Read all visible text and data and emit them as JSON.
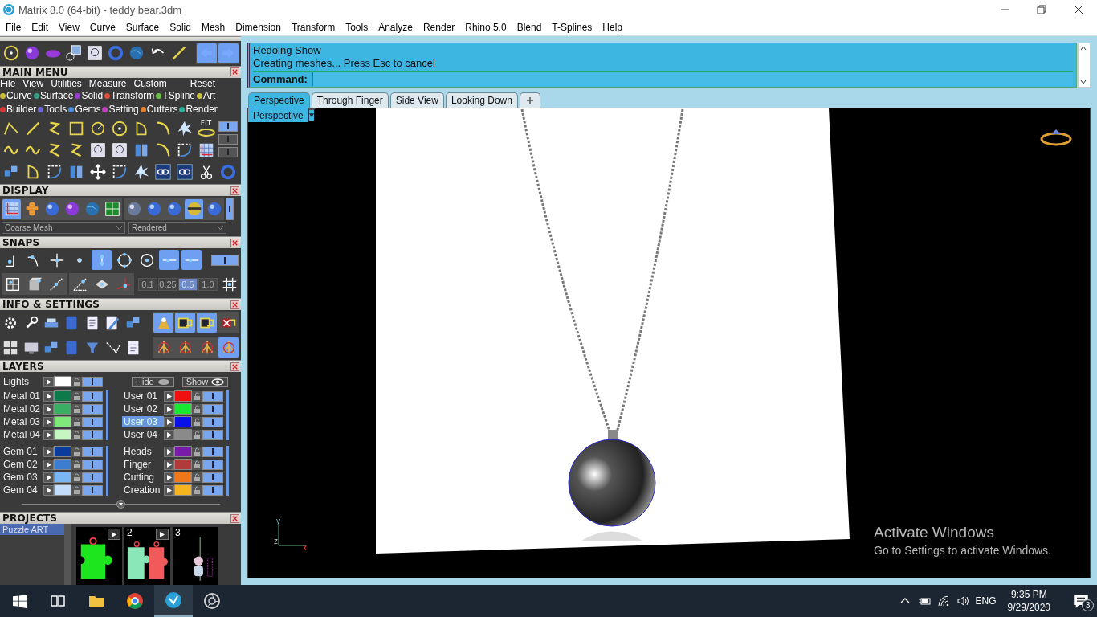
{
  "window": {
    "title": "Matrix 8.0 (64-bit) - teddy bear.3dm"
  },
  "menu_bar": [
    "File",
    "Edit",
    "View",
    "Curve",
    "Surface",
    "Solid",
    "Mesh",
    "Dimension",
    "Transform",
    "Tools",
    "Analyze",
    "Render",
    "Rhino 5.0",
    "Blend",
    "T-Splines",
    "Help"
  ],
  "main_menu": {
    "title": "MAIN MENU",
    "menu": [
      "File",
      "View",
      "Utilities",
      "Measure",
      "Custom"
    ],
    "reset": "Reset",
    "fit_label": "FIT",
    "toggles": [
      {
        "on": true
      },
      {
        "on": false
      },
      {
        "on": false
      }
    ],
    "categories": [
      {
        "label": "Curve",
        "color": "#cdbb3c"
      },
      {
        "label": "Surface",
        "color": "#3a9e86"
      },
      {
        "label": "Solid",
        "color": "#9b3fd1"
      },
      {
        "label": "Transform",
        "color": "#e0503a"
      },
      {
        "label": "TSpline",
        "color": "#6cbf48"
      },
      {
        "label": "Art",
        "color": "#c9c142"
      },
      {
        "label": "Builder",
        "color": "#d83a3a"
      },
      {
        "label": "Tools",
        "color": "#6b68d6"
      },
      {
        "label": "Gems",
        "color": "#4a8fd8"
      },
      {
        "label": "Setting",
        "color": "#c040c0"
      },
      {
        "label": "Cutters",
        "color": "#e08030"
      },
      {
        "label": "Render",
        "color": "#2fae9e"
      }
    ]
  },
  "display": {
    "title": "DISPLAY",
    "views": [
      {
        "on": true
      },
      {
        "on": false
      },
      {
        "on": false
      },
      {
        "on": false
      },
      {
        "on": false
      },
      {
        "on": false
      }
    ],
    "shades": [
      {
        "on": false
      },
      {
        "on": false
      },
      {
        "on": false
      },
      {
        "on": true
      },
      {
        "on": false
      }
    ],
    "panel_on": true,
    "mesh": "Coarse Mesh",
    "mode": "Rendered"
  },
  "snaps": {
    "title": "SNAPS",
    "buttons": [
      {
        "on": false
      },
      {
        "on": false
      },
      {
        "on": false
      },
      {
        "on": false
      },
      {
        "on": true
      },
      {
        "on": false
      },
      {
        "on": false
      },
      {
        "on": true
      },
      {
        "on": true
      }
    ],
    "panel_on": true,
    "values": [
      {
        "label": "0.1",
        "selected": false
      },
      {
        "label": "0.25",
        "selected": false
      },
      {
        "label": "0.5",
        "selected": true
      },
      {
        "label": "1.0",
        "selected": false
      }
    ]
  },
  "info": {
    "title": "INFO & SETTINGS"
  },
  "layers": {
    "title": "LAYERS",
    "lights": {
      "name": "Lights",
      "color": "#ffffff",
      "visible": true
    },
    "hide": "Hide",
    "show": "Show",
    "groups": [
      [
        {
          "name": "Metal 01",
          "color": "#0e7a4a",
          "selected": false,
          "visible": true
        },
        {
          "name": "Metal 02",
          "color": "#3aae62",
          "selected": false,
          "visible": true
        },
        {
          "name": "Metal 03",
          "color": "#7ee87a",
          "selected": false,
          "visible": true
        },
        {
          "name": "Metal 04",
          "color": "#c6f6c2",
          "selected": false,
          "visible": true
        }
      ],
      [
        {
          "name": "User 01",
          "color": "#f01010",
          "selected": false,
          "visible": true
        },
        {
          "name": "User 02",
          "color": "#18e830",
          "selected": false,
          "visible": true
        },
        {
          "name": "User 03",
          "color": "#0a10e8",
          "selected": true,
          "visible": true
        },
        {
          "name": "User 04",
          "color": "#8a8a8a",
          "selected": false,
          "visible": true
        }
      ],
      [
        {
          "name": "Gem 01",
          "color": "#0a3c9c",
          "selected": false,
          "visible": true
        },
        {
          "name": "Gem 02",
          "color": "#3e7cd0",
          "selected": false,
          "visible": true
        },
        {
          "name": "Gem 03",
          "color": "#7ab6f4",
          "selected": false,
          "visible": true
        },
        {
          "name": "Gem 04",
          "color": "#c2dcfa",
          "selected": false,
          "visible": true
        }
      ],
      [
        {
          "name": "Heads",
          "color": "#7a1aa8",
          "selected": false,
          "visible": true
        },
        {
          "name": "Finger",
          "color": "#b23a3a",
          "selected": false,
          "visible": true
        },
        {
          "name": "Cutting",
          "color": "#f07818",
          "selected": false,
          "visible": true
        },
        {
          "name": "Creation",
          "color": "#f6b41e",
          "selected": false,
          "visible": true
        }
      ]
    ]
  },
  "projects": {
    "title": "PROJECTS",
    "list": [
      {
        "label": "Puzzle ART",
        "selected": true
      }
    ],
    "thumbnails": [
      {
        "kind": "puzzle-single"
      },
      {
        "kind": "puzzle-pair",
        "number": "2"
      },
      {
        "kind": "bear",
        "number": "3"
      }
    ]
  },
  "command": {
    "history": [
      "Redoing Show",
      "Creating meshes... Press Esc to cancel"
    ],
    "prompt": "Command:"
  },
  "tabs": [
    {
      "label": "Perspective",
      "selected": true
    },
    {
      "label": "Through Finger",
      "selected": false
    },
    {
      "label": "Side View",
      "selected": false
    },
    {
      "label": "Looking Down",
      "selected": false
    }
  ],
  "viewport": {
    "label": "Perspective",
    "axes": [
      "y",
      "z",
      "x"
    ]
  },
  "activation": {
    "title": "Activate Windows",
    "subtitle": "Go to Settings to activate Windows."
  },
  "taskbar": {
    "language": "ENG",
    "time": "9:35 PM",
    "date": "9/29/2020",
    "notifications": "3"
  }
}
